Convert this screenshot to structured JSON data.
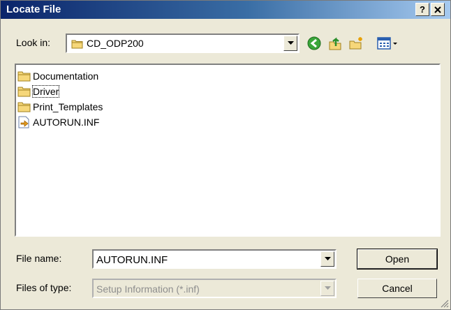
{
  "window": {
    "title": "Locate File",
    "help_label": "?",
    "close_label": "✕"
  },
  "lookin": {
    "label": "Look in:",
    "value": "CD_ODP200"
  },
  "files": [
    {
      "name": "Documentation",
      "icon": "folder-icon"
    },
    {
      "name": "Driver",
      "icon": "folder-icon"
    },
    {
      "name": "Print_Templates",
      "icon": "folder-icon"
    },
    {
      "name": "AUTORUN.INF",
      "icon": "setup-file-icon"
    }
  ],
  "filename": {
    "label": "File name:",
    "value": "AUTORUN.INF"
  },
  "filetype": {
    "label": "Files of type:",
    "value": "Setup Information (*.inf)"
  },
  "buttons": {
    "open_label": "Open",
    "cancel_label": "Cancel"
  }
}
